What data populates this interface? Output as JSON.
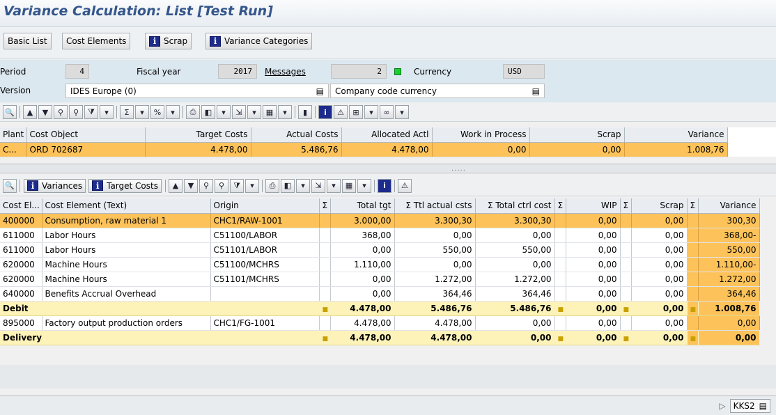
{
  "title": "Variance Calculation: List [Test Run]",
  "appbar": {
    "basic_list": "Basic List",
    "cost_elements": "Cost Elements",
    "scrap": "Scrap",
    "variance_categories": "Variance Categories",
    "info_glyph": "i"
  },
  "header": {
    "period_label": "Period",
    "period_value": "4",
    "fiscal_year_label": "Fiscal year",
    "fiscal_year_value": "2017",
    "messages_label": "Messages",
    "messages_value": "2",
    "currency_label": "Currency",
    "currency_value": "USD",
    "version_label": "Version",
    "version_value": "IDES Europe (0)",
    "currency_type_value": "Company code currency"
  },
  "toolbar2": {
    "variances_label": "Variances",
    "target_costs_label": "Target Costs"
  },
  "upper_table": {
    "headers": [
      "Plant",
      "Cost Object",
      "Target Costs",
      "Actual Costs",
      "Allocated Actl",
      "Work in Process",
      "Scrap",
      "Variance"
    ],
    "row": [
      "C...",
      "ORD 702687",
      "4.478,00",
      "5.486,76",
      "4.478,00",
      "0,00",
      "0,00",
      "1.008,76"
    ]
  },
  "lower_table": {
    "headers": [
      "Cost El...",
      "Cost Element (Text)",
      "Origin",
      "Σ",
      "Total tgt",
      "Σ Ttl actual csts",
      "Σ Total ctrl cost",
      "Σ",
      "WIP",
      "Σ",
      "Scrap",
      "Σ",
      "Variance"
    ],
    "rows": [
      {
        "code": "400000",
        "text": "Consumption, raw material 1",
        "origin": "CHC1/RAW-1001",
        "tgt": "3.000,00",
        "act": "3.300,30",
        "ctrl": "3.300,30",
        "wip": "0,00",
        "scrap": "0,00",
        "var": "300,30"
      },
      {
        "code": "611000",
        "text": "Labor Hours",
        "origin": "C51100/LABOR",
        "tgt": "368,00",
        "act": "0,00",
        "ctrl": "0,00",
        "wip": "0,00",
        "scrap": "0,00",
        "var": "368,00-"
      },
      {
        "code": "611000",
        "text": "Labor Hours",
        "origin": "C51101/LABOR",
        "tgt": "0,00",
        "act": "550,00",
        "ctrl": "550,00",
        "wip": "0,00",
        "scrap": "0,00",
        "var": "550,00"
      },
      {
        "code": "620000",
        "text": "Machine Hours",
        "origin": "C51100/MCHRS",
        "tgt": "1.110,00",
        "act": "0,00",
        "ctrl": "0,00",
        "wip": "0,00",
        "scrap": "0,00",
        "var": "1.110,00-"
      },
      {
        "code": "620000",
        "text": "Machine Hours",
        "origin": "C51101/MCHRS",
        "tgt": "0,00",
        "act": "1.272,00",
        "ctrl": "1.272,00",
        "wip": "0,00",
        "scrap": "0,00",
        "var": "1.272,00"
      },
      {
        "code": "640000",
        "text": "Benefits Accrual Overhead",
        "origin": "",
        "tgt": "0,00",
        "act": "364,46",
        "ctrl": "364,46",
        "wip": "0,00",
        "scrap": "0,00",
        "var": "364,46"
      }
    ],
    "debit": {
      "label": "Debit",
      "tgt": "4.478,00",
      "act": "5.486,76",
      "ctrl": "5.486,76",
      "wip": "0,00",
      "scrap": "0,00",
      "var": "1.008,76"
    },
    "row_895": {
      "code": "895000",
      "text": "Factory output production orders",
      "origin": "CHC1/FG-1001",
      "tgt": "4.478,00",
      "act": "4.478,00",
      "ctrl": "0,00",
      "wip": "0,00",
      "scrap": "0,00",
      "var": "0,00"
    },
    "delivery": {
      "label": "Delivery",
      "tgt": "4.478,00",
      "act": "4.478,00",
      "ctrl": "0,00",
      "wip": "0,00",
      "scrap": "0,00",
      "var": "0,00"
    }
  },
  "status": {
    "system": "KKS2"
  },
  "colors": {
    "selected_row": "#fdc35a",
    "sum_row": "#fdf3b8",
    "header_area": "#dce8f0",
    "title": "#34568b"
  }
}
